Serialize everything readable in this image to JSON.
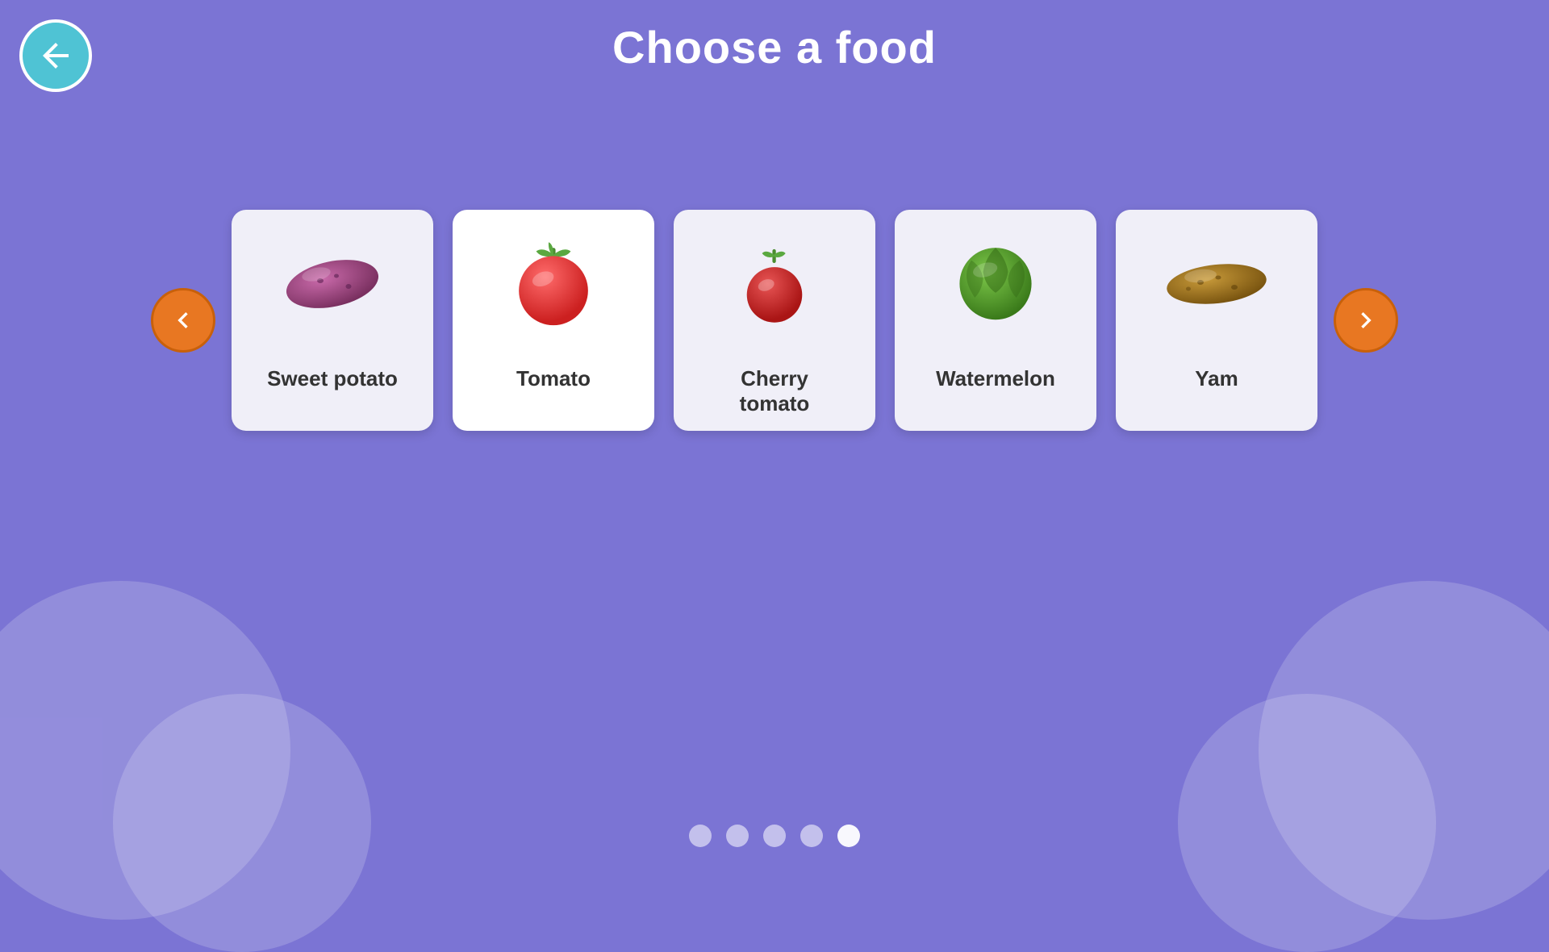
{
  "page": {
    "title": "Choose a food",
    "background_color": "#7B74D4"
  },
  "back_button": {
    "label": "back"
  },
  "nav": {
    "prev_label": "previous",
    "next_label": "next"
  },
  "foods": [
    {
      "id": "sweet-potato",
      "name": "Sweet potato",
      "bg": "lavender"
    },
    {
      "id": "tomato",
      "name": "Tomato",
      "bg": "white"
    },
    {
      "id": "cherry-tomato",
      "name": "Cherry tomato",
      "bg": "lavender"
    },
    {
      "id": "watermelon",
      "name": "Watermelon",
      "bg": "lavender"
    },
    {
      "id": "yam",
      "name": "Yam",
      "bg": "lavender"
    }
  ],
  "dots": [
    {
      "active": false
    },
    {
      "active": false
    },
    {
      "active": false
    },
    {
      "active": false
    },
    {
      "active": true
    }
  ]
}
